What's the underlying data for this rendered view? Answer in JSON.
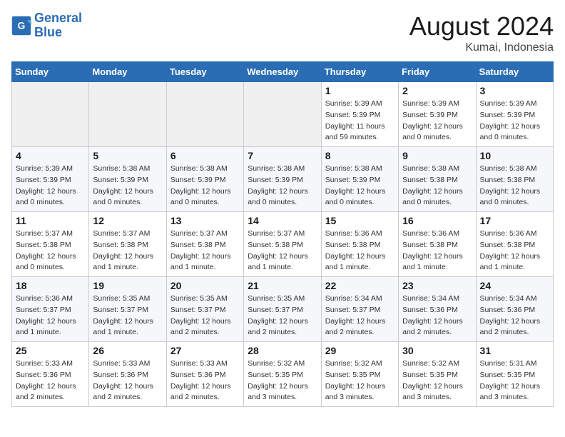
{
  "logo": {
    "line1": "General",
    "line2": "Blue"
  },
  "header": {
    "month_year": "August 2024",
    "location": "Kumai, Indonesia"
  },
  "weekdays": [
    "Sunday",
    "Monday",
    "Tuesday",
    "Wednesday",
    "Thursday",
    "Friday",
    "Saturday"
  ],
  "weeks": [
    [
      {
        "day": "",
        "info": ""
      },
      {
        "day": "",
        "info": ""
      },
      {
        "day": "",
        "info": ""
      },
      {
        "day": "",
        "info": ""
      },
      {
        "day": "1",
        "info": "Sunrise: 5:39 AM\nSunset: 5:39 PM\nDaylight: 11 hours\nand 59 minutes."
      },
      {
        "day": "2",
        "info": "Sunrise: 5:39 AM\nSunset: 5:39 PM\nDaylight: 12 hours\nand 0 minutes."
      },
      {
        "day": "3",
        "info": "Sunrise: 5:39 AM\nSunset: 5:39 PM\nDaylight: 12 hours\nand 0 minutes."
      }
    ],
    [
      {
        "day": "4",
        "info": "Sunrise: 5:39 AM\nSunset: 5:39 PM\nDaylight: 12 hours\nand 0 minutes."
      },
      {
        "day": "5",
        "info": "Sunrise: 5:38 AM\nSunset: 5:39 PM\nDaylight: 12 hours\nand 0 minutes."
      },
      {
        "day": "6",
        "info": "Sunrise: 5:38 AM\nSunset: 5:39 PM\nDaylight: 12 hours\nand 0 minutes."
      },
      {
        "day": "7",
        "info": "Sunrise: 5:38 AM\nSunset: 5:39 PM\nDaylight: 12 hours\nand 0 minutes."
      },
      {
        "day": "8",
        "info": "Sunrise: 5:38 AM\nSunset: 5:39 PM\nDaylight: 12 hours\nand 0 minutes."
      },
      {
        "day": "9",
        "info": "Sunrise: 5:38 AM\nSunset: 5:38 PM\nDaylight: 12 hours\nand 0 minutes."
      },
      {
        "day": "10",
        "info": "Sunrise: 5:38 AM\nSunset: 5:38 PM\nDaylight: 12 hours\nand 0 minutes."
      }
    ],
    [
      {
        "day": "11",
        "info": "Sunrise: 5:37 AM\nSunset: 5:38 PM\nDaylight: 12 hours\nand 0 minutes."
      },
      {
        "day": "12",
        "info": "Sunrise: 5:37 AM\nSunset: 5:38 PM\nDaylight: 12 hours\nand 1 minute."
      },
      {
        "day": "13",
        "info": "Sunrise: 5:37 AM\nSunset: 5:38 PM\nDaylight: 12 hours\nand 1 minute."
      },
      {
        "day": "14",
        "info": "Sunrise: 5:37 AM\nSunset: 5:38 PM\nDaylight: 12 hours\nand 1 minute."
      },
      {
        "day": "15",
        "info": "Sunrise: 5:36 AM\nSunset: 5:38 PM\nDaylight: 12 hours\nand 1 minute."
      },
      {
        "day": "16",
        "info": "Sunrise: 5:36 AM\nSunset: 5:38 PM\nDaylight: 12 hours\nand 1 minute."
      },
      {
        "day": "17",
        "info": "Sunrise: 5:36 AM\nSunset: 5:38 PM\nDaylight: 12 hours\nand 1 minute."
      }
    ],
    [
      {
        "day": "18",
        "info": "Sunrise: 5:36 AM\nSunset: 5:37 PM\nDaylight: 12 hours\nand 1 minute."
      },
      {
        "day": "19",
        "info": "Sunrise: 5:35 AM\nSunset: 5:37 PM\nDaylight: 12 hours\nand 1 minute."
      },
      {
        "day": "20",
        "info": "Sunrise: 5:35 AM\nSunset: 5:37 PM\nDaylight: 12 hours\nand 2 minutes."
      },
      {
        "day": "21",
        "info": "Sunrise: 5:35 AM\nSunset: 5:37 PM\nDaylight: 12 hours\nand 2 minutes."
      },
      {
        "day": "22",
        "info": "Sunrise: 5:34 AM\nSunset: 5:37 PM\nDaylight: 12 hours\nand 2 minutes."
      },
      {
        "day": "23",
        "info": "Sunrise: 5:34 AM\nSunset: 5:36 PM\nDaylight: 12 hours\nand 2 minutes."
      },
      {
        "day": "24",
        "info": "Sunrise: 5:34 AM\nSunset: 5:36 PM\nDaylight: 12 hours\nand 2 minutes."
      }
    ],
    [
      {
        "day": "25",
        "info": "Sunrise: 5:33 AM\nSunset: 5:36 PM\nDaylight: 12 hours\nand 2 minutes."
      },
      {
        "day": "26",
        "info": "Sunrise: 5:33 AM\nSunset: 5:36 PM\nDaylight: 12 hours\nand 2 minutes."
      },
      {
        "day": "27",
        "info": "Sunrise: 5:33 AM\nSunset: 5:36 PM\nDaylight: 12 hours\nand 2 minutes."
      },
      {
        "day": "28",
        "info": "Sunrise: 5:32 AM\nSunset: 5:35 PM\nDaylight: 12 hours\nand 3 minutes."
      },
      {
        "day": "29",
        "info": "Sunrise: 5:32 AM\nSunset: 5:35 PM\nDaylight: 12 hours\nand 3 minutes."
      },
      {
        "day": "30",
        "info": "Sunrise: 5:32 AM\nSunset: 5:35 PM\nDaylight: 12 hours\nand 3 minutes."
      },
      {
        "day": "31",
        "info": "Sunrise: 5:31 AM\nSunset: 5:35 PM\nDaylight: 12 hours\nand 3 minutes."
      }
    ]
  ]
}
